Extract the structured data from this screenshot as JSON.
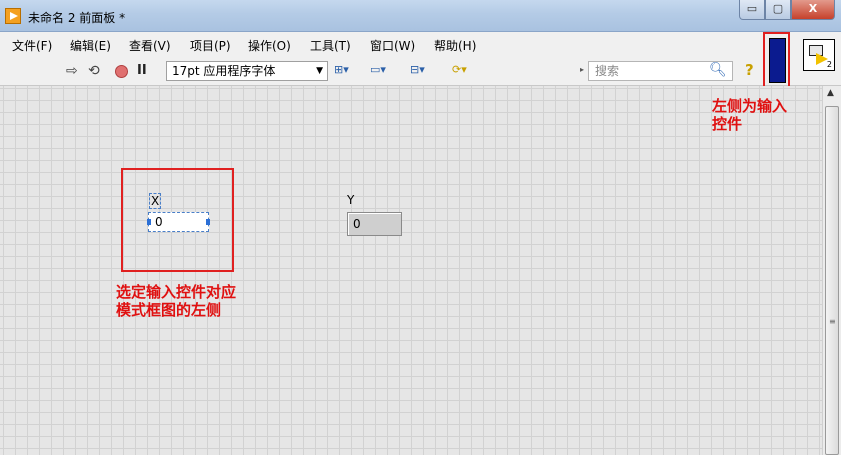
{
  "window": {
    "title": "未命名 2 前面板 *",
    "buttons": {
      "minimize": "▭",
      "maximize": "▢",
      "close": "X"
    }
  },
  "menu": [
    "文件(F)",
    "编辑(E)",
    "查看(V)",
    "项目(P)",
    "操作(O)",
    "工具(T)",
    "窗口(W)",
    "帮助(H)"
  ],
  "toolbar": {
    "run": "⇨",
    "run_continuously": "⟲",
    "pause": "II",
    "font": "17pt 应用程序字体",
    "align": "⊞▾",
    "distribute": "▭▾",
    "resize": "⊟▾",
    "reorder": "⟳▾",
    "search_placeholder": "搜索",
    "search_icon": "search-icon",
    "help": "?",
    "vi_icon_number": "2"
  },
  "panel": {
    "control": {
      "label": "X",
      "value": "0"
    },
    "indicator": {
      "label": "Y",
      "value": "0"
    }
  },
  "annotations": {
    "left": "选定输入控件对应模式框图的左侧",
    "right": "左侧为输入控件"
  },
  "colors": {
    "annotation": "#e02020",
    "connector_pane": "#0b1b8f",
    "grid": "#d2d2d2"
  }
}
